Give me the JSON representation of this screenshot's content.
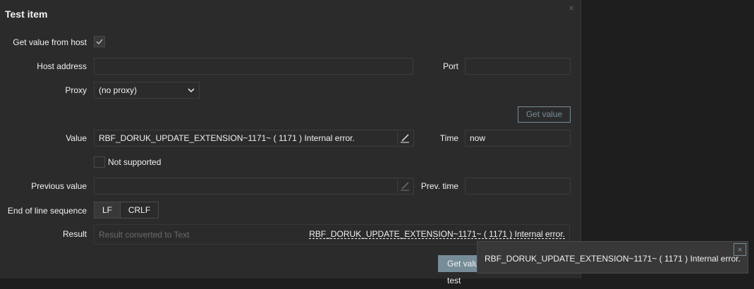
{
  "dialog": {
    "title": "Test item",
    "close_glyph": "×"
  },
  "form": {
    "get_value_from_host": {
      "label": "Get value from host",
      "checked": true
    },
    "host_address": {
      "label": "Host address",
      "value": ""
    },
    "port": {
      "label": "Port",
      "value": ""
    },
    "proxy": {
      "label": "Proxy",
      "value": "(no proxy)"
    },
    "get_value_button": "Get value",
    "value": {
      "label": "Value",
      "value": "RBF_DORUK_UPDATE_EXTENSION~1171~ ( 1171 ) Internal error."
    },
    "time": {
      "label": "Time",
      "value": "now"
    },
    "not_supported": {
      "label": "Not supported",
      "checked": false
    },
    "previous_value": {
      "label": "Previous value",
      "value": ""
    },
    "prev_time": {
      "label": "Prev. time",
      "value": ""
    },
    "eol": {
      "label": "End of line sequence",
      "options": [
        "LF",
        "CRLF"
      ],
      "selected": "LF"
    },
    "result": {
      "label": "Result",
      "placeholder": "Result converted to Text",
      "value": "RBF_DORUK_UPDATE_EXTENSION~1171~ ( 1171 ) Internal error."
    }
  },
  "footer": {
    "primary_button": "Get value and test"
  },
  "tooltip": {
    "text": "RBF_DORUK_UPDATE_EXTENSION~1171~ ( 1171 ) Internal error.",
    "close_glyph": "×"
  },
  "colors": {
    "accent": "#768d99",
    "background": "#2b2b2b",
    "page": "#1e1e1e"
  }
}
